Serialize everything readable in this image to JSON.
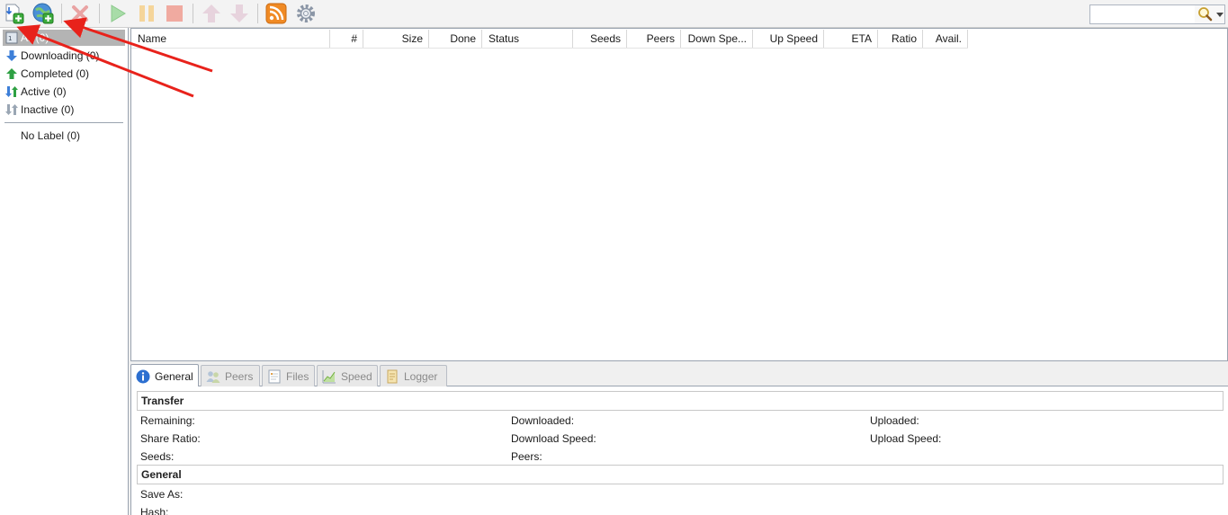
{
  "toolbar": {
    "buttons": [
      {
        "name": "add-torrent-file",
        "icon": "add-file-icon"
      },
      {
        "name": "add-torrent-url",
        "icon": "add-url-icon"
      },
      {
        "name": "remove",
        "icon": "remove-icon"
      },
      {
        "name": "start",
        "icon": "play-icon"
      },
      {
        "name": "pause",
        "icon": "pause-icon"
      },
      {
        "name": "stop",
        "icon": "stop-icon"
      },
      {
        "name": "move-up",
        "icon": "arrow-up-icon"
      },
      {
        "name": "move-down",
        "icon": "arrow-down-icon"
      },
      {
        "name": "rss",
        "icon": "rss-icon"
      },
      {
        "name": "preferences",
        "icon": "gear-icon"
      }
    ],
    "search_placeholder": ""
  },
  "sidebar": {
    "items": [
      {
        "label": "All (0)",
        "icon": "all-icon"
      },
      {
        "label": "Downloading (0)",
        "icon": "download-arrow-icon"
      },
      {
        "label": "Completed (0)",
        "icon": "upload-arrow-icon"
      },
      {
        "label": "Active (0)",
        "icon": "active-arrows-icon"
      },
      {
        "label": "Inactive (0)",
        "icon": "inactive-arrows-icon"
      }
    ],
    "no_label": "No Label (0)"
  },
  "list": {
    "columns": [
      "Name",
      "#",
      "Size",
      "Done",
      "Status",
      "Seeds",
      "Peers",
      "Down Spe...",
      "Up Speed",
      "ETA",
      "Ratio",
      "Avail."
    ]
  },
  "tabs": [
    {
      "label": "General",
      "icon": "info-icon"
    },
    {
      "label": "Peers",
      "icon": "peers-icon"
    },
    {
      "label": "Files",
      "icon": "files-icon"
    },
    {
      "label": "Speed",
      "icon": "speed-chart-icon"
    },
    {
      "label": "Logger",
      "icon": "logger-icon"
    }
  ],
  "details": {
    "transfer_title": "Transfer",
    "general_title": "General",
    "remaining": "Remaining:",
    "downloaded": "Downloaded:",
    "uploaded": "Uploaded:",
    "share_ratio": "Share Ratio:",
    "download_speed": "Download Speed:",
    "upload_speed": "Upload Speed:",
    "seeds": "Seeds:",
    "peers": "Peers:",
    "save_as": "Save As:",
    "hash": "Hash:"
  },
  "colors": {
    "annotation_arrow": "#e8221b",
    "selected_item": "#b4b4b4",
    "border": "#9aa3b0"
  }
}
